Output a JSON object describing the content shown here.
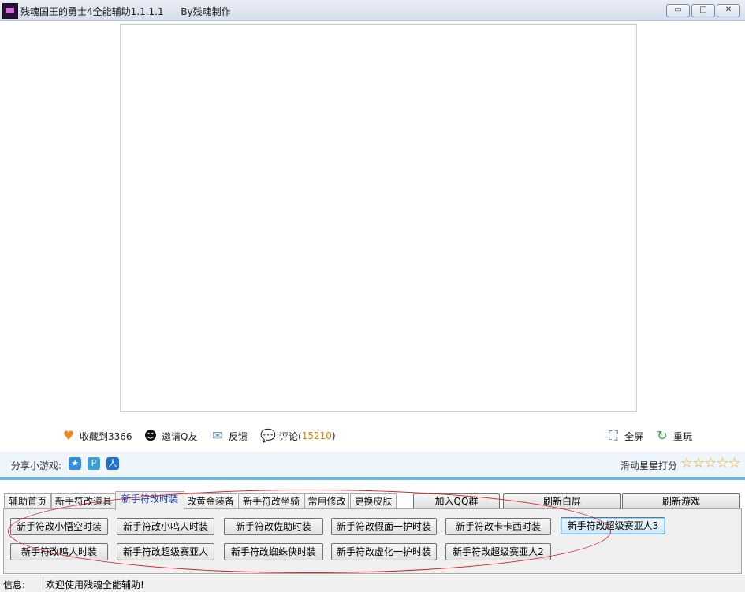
{
  "window": {
    "title": "残魂国王的勇士4全能辅助1.1.1.1",
    "author": "By残魂制作",
    "min_glyph": "▭",
    "max_glyph": "□",
    "close_glyph": "✕"
  },
  "toolbar": {
    "favorite_text": "收藏到3366",
    "invite_text": "邀请Q友",
    "feedback_text": "反馈",
    "comment_text": "评论(",
    "comment_count": "15210",
    "comment_close": ")",
    "fullscreen_text": "全屏",
    "replay_text": "重玩",
    "icons": [
      "heart-icon",
      "penguin-icon",
      "mail-icon",
      "comment-icon",
      "fullscreen-icon",
      "replay-icon"
    ]
  },
  "share": {
    "label": "分享小游戏:",
    "rate_label": "滑动星星打分",
    "stars": "☆☆☆☆☆",
    "colors": {
      "accent_line": "#6db7ea",
      "star": "#f2a52a"
    }
  },
  "tabs": [
    {
      "label": "辅助首页"
    },
    {
      "label": "新手符改道具"
    },
    {
      "label": "新手符改时装"
    },
    {
      "label": "改黄金装备"
    },
    {
      "label": "新手符改坐骑"
    },
    {
      "label": "常用修改"
    },
    {
      "label": "更换皮肤"
    }
  ],
  "actions": {
    "join_qq": "加入QQ群",
    "refresh_white": "刷新白屏",
    "refresh_game": "刷新游戏"
  },
  "costume_buttons": {
    "row1": [
      "新手符改小悟空时装",
      "新手符改小鸣人时装",
      "新手符改佐助时装",
      "新手符改假面一护时装",
      "新手符改卡卡西时装",
      "新手符改超级赛亚人3"
    ],
    "row2": [
      "新手符改鸣人时装",
      "新手符改超级赛亚人",
      "新手符改蜘蛛侠时装",
      "新手符改虚化一护时装",
      "新手符改超级赛亚人2"
    ]
  },
  "status": {
    "label": "信息:",
    "text": "欢迎使用残魂全能辅助!"
  }
}
